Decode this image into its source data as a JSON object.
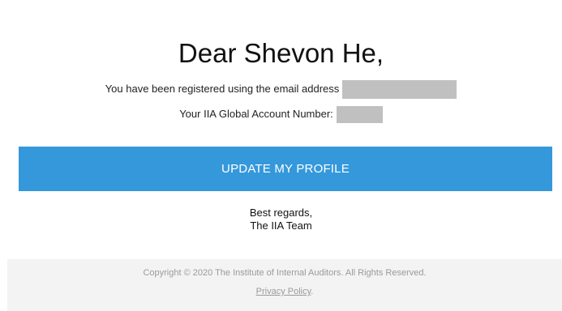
{
  "greeting": "Dear Shevon He,",
  "registration": {
    "text": "You have been registered using the email address",
    "email_redacted": true
  },
  "account": {
    "label": "Your IIA Global Account Number:",
    "number_redacted": true
  },
  "cta": {
    "label": "UPDATE MY PROFILE",
    "color": "#3498db"
  },
  "signoff": {
    "line1": "Best regards,",
    "line2": "The IIA Team"
  },
  "footer": {
    "copyright": "Copyright © 2020 The Institute of Internal Auditors. All Rights Reserved.",
    "privacy_label": "Privacy Policy",
    "privacy_suffix": "."
  }
}
